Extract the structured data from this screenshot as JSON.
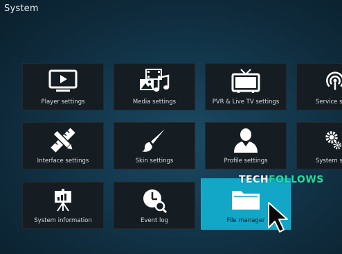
{
  "header": {
    "title": "System"
  },
  "tiles": [
    {
      "label": "Player settings",
      "icon": "monitor-play-icon"
    },
    {
      "label": "Media settings",
      "icon": "media-icon"
    },
    {
      "label": "PVR & Live TV settings",
      "icon": "tv-icon"
    },
    {
      "label": "Service se",
      "icon": "broadcast-icon"
    },
    {
      "label": "Interface settings",
      "icon": "pencil-ruler-icon"
    },
    {
      "label": "Skin settings",
      "icon": "paintbrush-icon"
    },
    {
      "label": "Profile settings",
      "icon": "user-icon"
    },
    {
      "label": "System se",
      "icon": "gears-icon"
    },
    {
      "label": "System information",
      "icon": "presentation-board-icon"
    },
    {
      "label": "Event log",
      "icon": "clock-search-icon"
    },
    {
      "label": "File manager",
      "icon": "folder-icon"
    }
  ],
  "watermark": {
    "part1": "TECH",
    "part2": "FOLLOWS"
  },
  "colors": {
    "focus_tile": "#12a6c7",
    "tile": "#161d22",
    "watermark_accent": "#1fe0a0"
  }
}
